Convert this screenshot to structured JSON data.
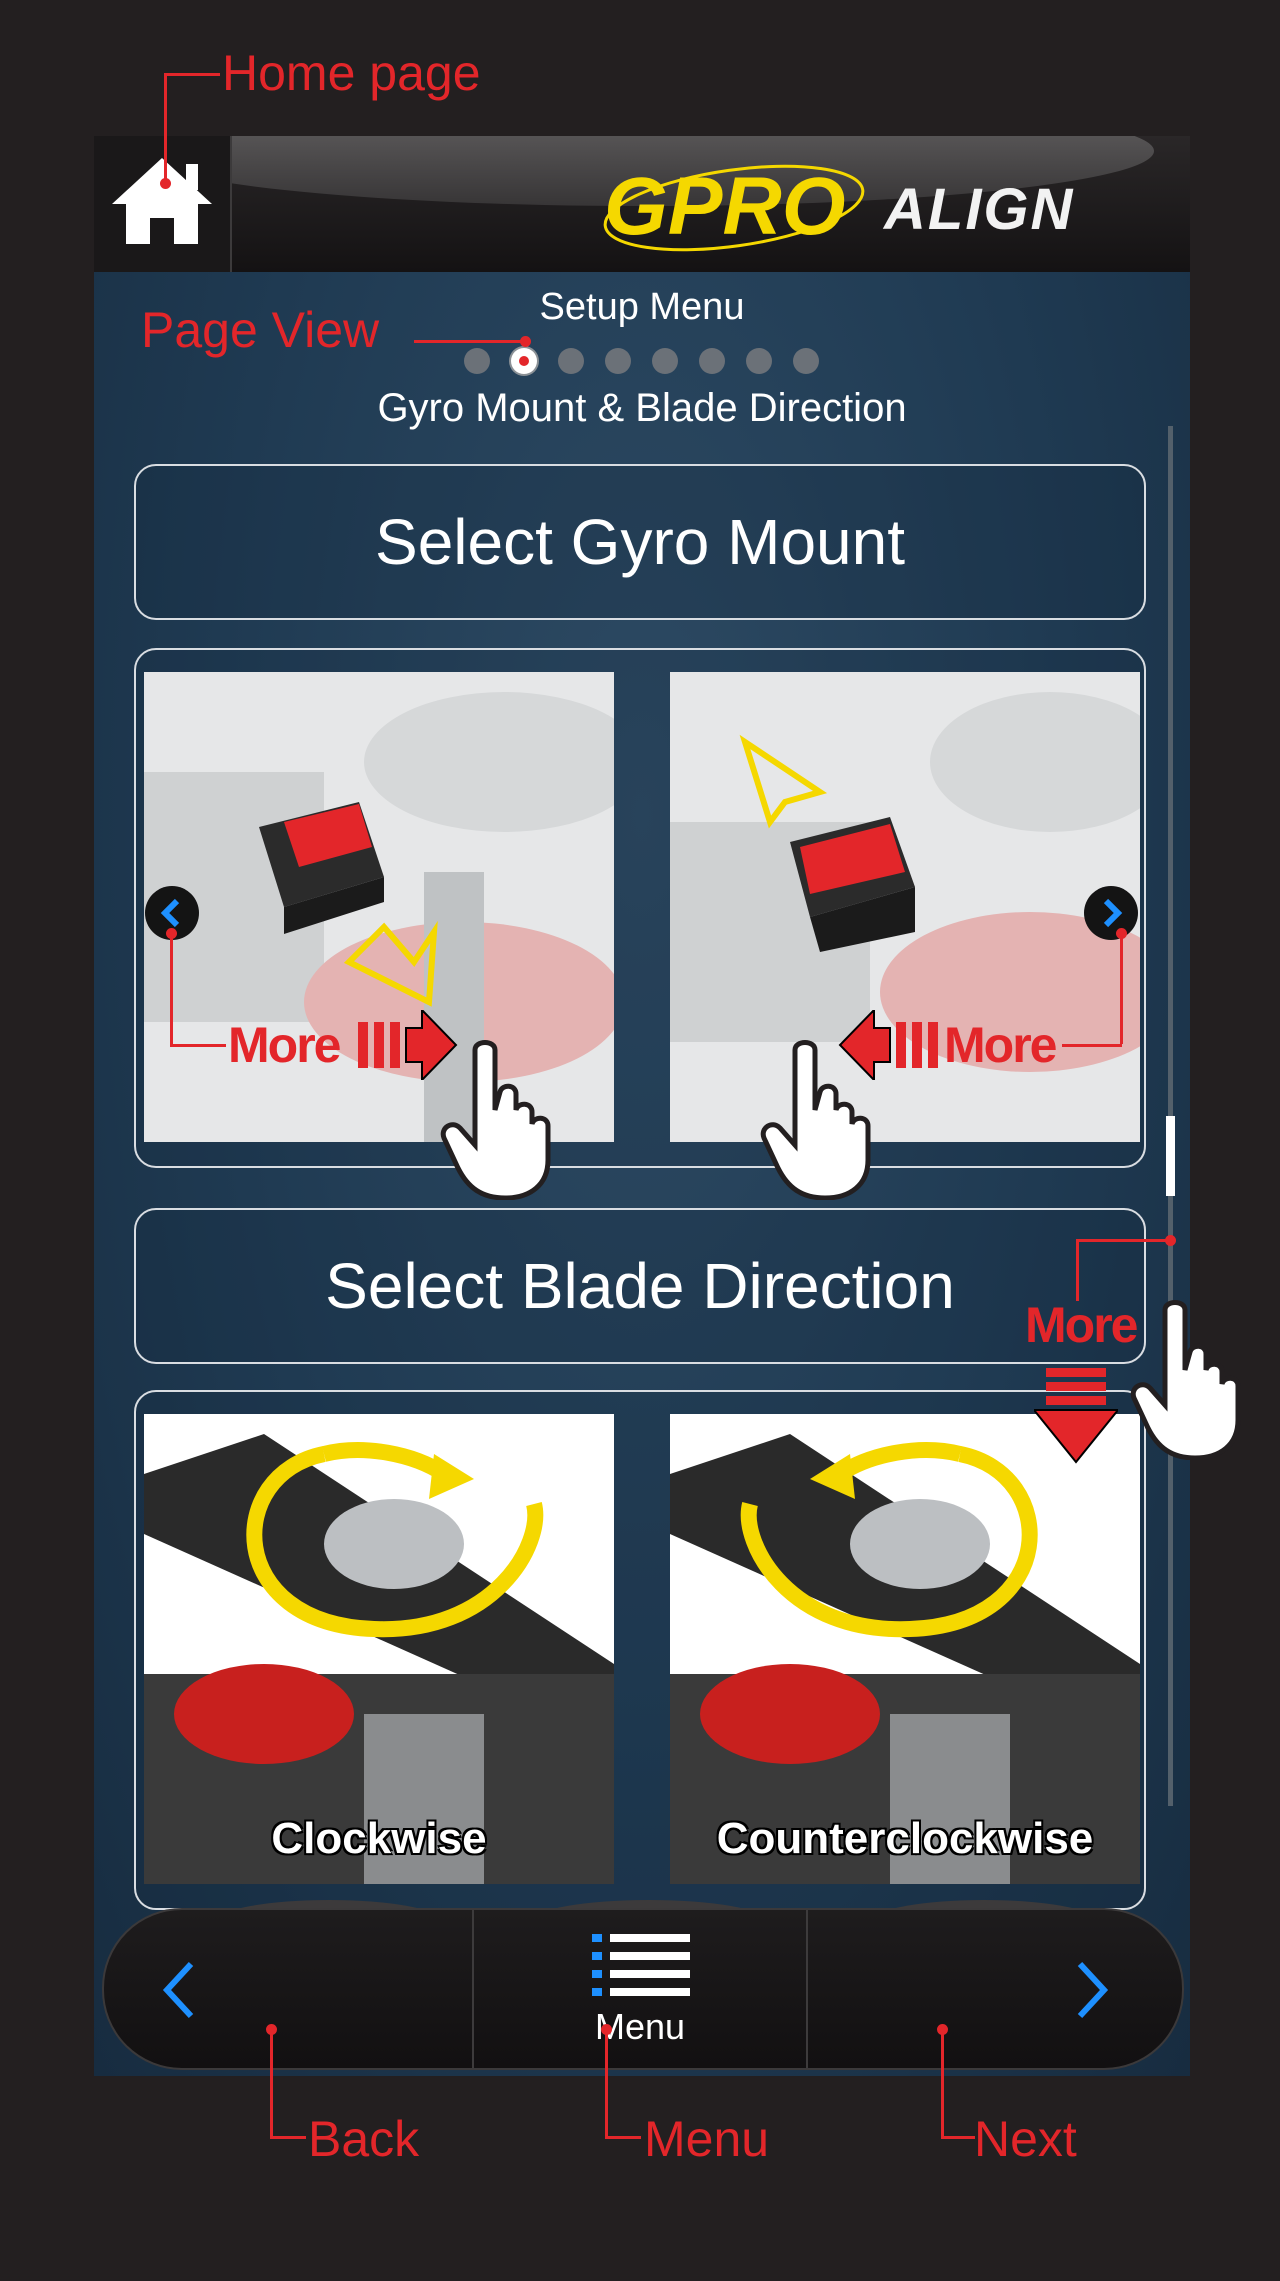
{
  "annotations": {
    "home_page": "Home page",
    "page_view": "Page View",
    "more": "More",
    "back": "Back",
    "menu": "Menu",
    "next": "Next"
  },
  "header": {
    "logo_gpro": "GPRO",
    "logo_align": "ALIGN"
  },
  "page": {
    "menu_title": "Setup Menu",
    "subtitle": "Gyro Mount & Blade Direction",
    "page_count": 8,
    "active_page": 2
  },
  "sections": {
    "gyro_mount_title": "Select Gyro Mount",
    "blade_direction_title": "Select Blade Direction",
    "clockwise": "Clockwise",
    "counterclockwise": "Counterclockwise"
  },
  "bottom_nav": {
    "menu_label": "Menu"
  },
  "colors": {
    "annotation_red": "#e3262a",
    "accent_blue": "#1e90ff",
    "gpro_yellow": "#f5d800",
    "screen_bg": "#1f3a52"
  },
  "icons": [
    "home-icon",
    "chevron-left-icon",
    "chevron-right-icon",
    "menu-icon",
    "hand-pointer-icon",
    "arrow-down-icon"
  ]
}
